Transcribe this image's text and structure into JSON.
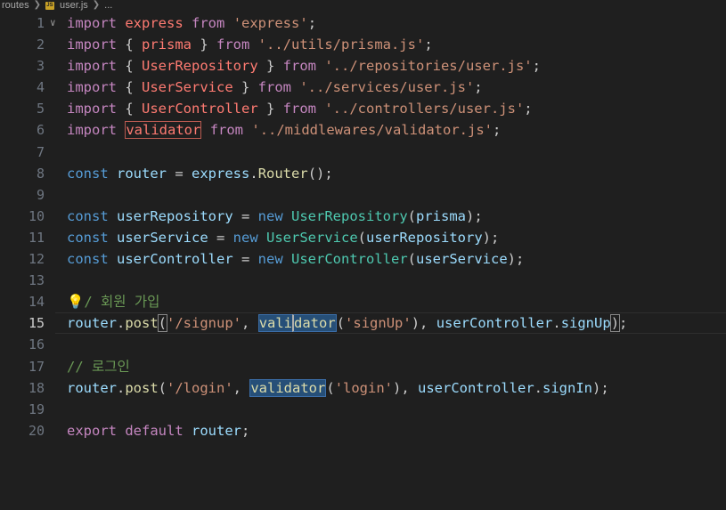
{
  "breadcrumb": {
    "folder": "routes",
    "file": "user.js",
    "more": "...",
    "file_icon_text": "JS"
  },
  "lines": [
    {
      "n": "1",
      "parts": [
        {
          "t": "import",
          "c": "ctrl"
        },
        {
          "t": " "
        },
        {
          "t": "express",
          "c": "id"
        },
        {
          "t": " "
        },
        {
          "t": "from",
          "c": "ctrl"
        },
        {
          "t": " "
        },
        {
          "t": "'express'",
          "c": "str"
        },
        {
          "t": ";",
          "c": "plain"
        }
      ]
    },
    {
      "n": "2",
      "parts": [
        {
          "t": "import",
          "c": "ctrl"
        },
        {
          "t": " { "
        },
        {
          "t": "prisma",
          "c": "id"
        },
        {
          "t": " } "
        },
        {
          "t": "from",
          "c": "ctrl"
        },
        {
          "t": " "
        },
        {
          "t": "'../utils/prisma.js'",
          "c": "str"
        },
        {
          "t": ";",
          "c": "plain"
        }
      ]
    },
    {
      "n": "3",
      "parts": [
        {
          "t": "import",
          "c": "ctrl"
        },
        {
          "t": " { "
        },
        {
          "t": "UserRepository",
          "c": "id"
        },
        {
          "t": " } "
        },
        {
          "t": "from",
          "c": "ctrl"
        },
        {
          "t": " "
        },
        {
          "t": "'../repositories/user.js'",
          "c": "str"
        },
        {
          "t": ";",
          "c": "plain"
        }
      ]
    },
    {
      "n": "4",
      "parts": [
        {
          "t": "import",
          "c": "ctrl"
        },
        {
          "t": " { "
        },
        {
          "t": "UserService",
          "c": "id"
        },
        {
          "t": " } "
        },
        {
          "t": "from",
          "c": "ctrl"
        },
        {
          "t": " "
        },
        {
          "t": "'../services/user.js'",
          "c": "str"
        },
        {
          "t": ";",
          "c": "plain"
        }
      ]
    },
    {
      "n": "5",
      "parts": [
        {
          "t": "import",
          "c": "ctrl"
        },
        {
          "t": " { "
        },
        {
          "t": "UserController",
          "c": "id"
        },
        {
          "t": " } "
        },
        {
          "t": "from",
          "c": "ctrl"
        },
        {
          "t": " "
        },
        {
          "t": "'../controllers/user.js'",
          "c": "str"
        },
        {
          "t": ";",
          "c": "plain"
        }
      ]
    },
    {
      "n": "6",
      "parts": [
        {
          "t": "import",
          "c": "ctrl"
        },
        {
          "t": " "
        },
        {
          "t": "validator",
          "c": "id",
          "hl": "box"
        },
        {
          "t": " "
        },
        {
          "t": "from",
          "c": "ctrl"
        },
        {
          "t": " "
        },
        {
          "t": "'../middlewares/validator.js'",
          "c": "str"
        },
        {
          "t": ";",
          "c": "plain"
        }
      ]
    },
    {
      "n": "7",
      "parts": []
    },
    {
      "n": "8",
      "parts": [
        {
          "t": "const",
          "c": "kw"
        },
        {
          "t": " "
        },
        {
          "t": "router",
          "c": "var"
        },
        {
          "t": " = "
        },
        {
          "t": "express",
          "c": "var"
        },
        {
          "t": "."
        },
        {
          "t": "Router",
          "c": "fn"
        },
        {
          "t": "();",
          "c": "plain"
        }
      ]
    },
    {
      "n": "9",
      "parts": []
    },
    {
      "n": "10",
      "parts": [
        {
          "t": "const",
          "c": "kw"
        },
        {
          "t": " "
        },
        {
          "t": "userRepository",
          "c": "var"
        },
        {
          "t": " = "
        },
        {
          "t": "new",
          "c": "kw"
        },
        {
          "t": " "
        },
        {
          "t": "UserRepository",
          "c": "cls"
        },
        {
          "t": "("
        },
        {
          "t": "prisma",
          "c": "var"
        },
        {
          "t": ");"
        }
      ]
    },
    {
      "n": "11",
      "parts": [
        {
          "t": "const",
          "c": "kw"
        },
        {
          "t": " "
        },
        {
          "t": "userService",
          "c": "var"
        },
        {
          "t": " = "
        },
        {
          "t": "new",
          "c": "kw"
        },
        {
          "t": " "
        },
        {
          "t": "UserService",
          "c": "cls"
        },
        {
          "t": "("
        },
        {
          "t": "userRepository",
          "c": "var"
        },
        {
          "t": ");"
        }
      ]
    },
    {
      "n": "12",
      "parts": [
        {
          "t": "const",
          "c": "kw"
        },
        {
          "t": " "
        },
        {
          "t": "userController",
          "c": "var"
        },
        {
          "t": " = "
        },
        {
          "t": "new",
          "c": "kw"
        },
        {
          "t": " "
        },
        {
          "t": "UserController",
          "c": "cls"
        },
        {
          "t": "("
        },
        {
          "t": "userService",
          "c": "var"
        },
        {
          "t": ");"
        }
      ]
    },
    {
      "n": "13",
      "parts": []
    },
    {
      "n": "14",
      "parts": [
        {
          "t": "💡",
          "c": "bulb"
        },
        {
          "t": "/ 회원 가입",
          "c": "com"
        }
      ]
    },
    {
      "n": "15",
      "current": true,
      "parts": [
        {
          "t": "router",
          "c": "var"
        },
        {
          "t": "."
        },
        {
          "t": "post",
          "c": "fn"
        },
        {
          "t": "(",
          "bm": true
        },
        {
          "t": "'/signup'",
          "c": "str"
        },
        {
          "t": ", "
        },
        {
          "t": "vali",
          "c": "fn",
          "hl": "sel"
        },
        {
          "t": "dator",
          "c": "fn",
          "hl": "sel",
          "cursor": true
        },
        {
          "t": "("
        },
        {
          "t": "'signUp'",
          "c": "str"
        },
        {
          "t": "), "
        },
        {
          "t": "userController",
          "c": "var"
        },
        {
          "t": "."
        },
        {
          "t": "signUp",
          "c": "var"
        },
        {
          "t": ")",
          "bm": true
        },
        {
          "t": ";"
        }
      ]
    },
    {
      "n": "16",
      "parts": []
    },
    {
      "n": "17",
      "parts": [
        {
          "t": "// 로그인",
          "c": "com"
        }
      ]
    },
    {
      "n": "18",
      "parts": [
        {
          "t": "router",
          "c": "var"
        },
        {
          "t": "."
        },
        {
          "t": "post",
          "c": "fn"
        },
        {
          "t": "("
        },
        {
          "t": "'/login'",
          "c": "str"
        },
        {
          "t": ", "
        },
        {
          "t": "validator",
          "c": "fn",
          "hl": "sel"
        },
        {
          "t": "("
        },
        {
          "t": "'login'",
          "c": "str"
        },
        {
          "t": "), "
        },
        {
          "t": "userController",
          "c": "var"
        },
        {
          "t": "."
        },
        {
          "t": "signIn",
          "c": "var"
        },
        {
          "t": ");"
        }
      ]
    },
    {
      "n": "19",
      "parts": []
    },
    {
      "n": "20",
      "parts": [
        {
          "t": "export",
          "c": "ctrl"
        },
        {
          "t": " "
        },
        {
          "t": "default",
          "c": "ctrl"
        },
        {
          "t": " "
        },
        {
          "t": "router",
          "c": "var"
        },
        {
          "t": ";"
        }
      ]
    }
  ]
}
